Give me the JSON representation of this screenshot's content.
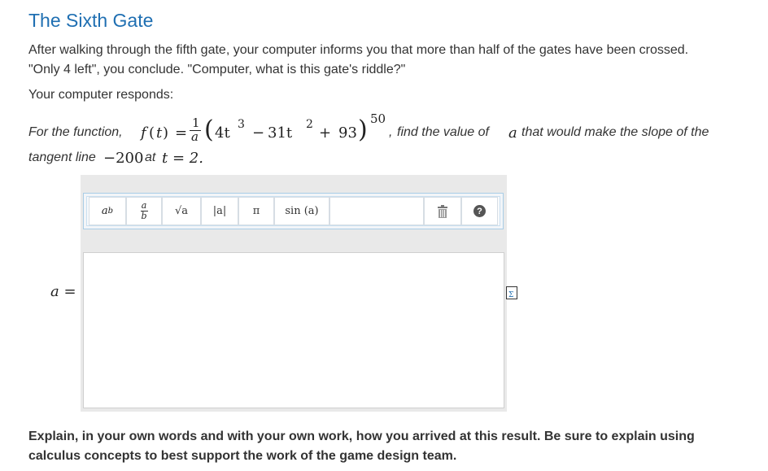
{
  "page": {
    "title": "The Sixth Gate",
    "intro": "After walking through the fifth gate, your computer informs you that more than half of the gates have been crossed. \"Only 4 left\", you conclude. \"Computer, what is this gate's riddle?\"",
    "responds": "Your computer responds:"
  },
  "problem": {
    "lead": "For the function,",
    "func": "f",
    "var": "t",
    "paren_l": "(",
    "paren_r": ")",
    "equals": "=",
    "frac_num": "1",
    "frac_den": "a",
    "term1": "4t",
    "exp1": "3",
    "minus": "−",
    "term2": "31t",
    "exp2": "2",
    "plus": "+",
    "term3": "93",
    "outer_exp": "50",
    "comma": ",",
    "mid": "find the value of",
    "a_var": "a",
    "tail": "that would make the slope of the",
    "line2_lead": "tangent line",
    "slope_value": "−200",
    "at": "at",
    "t_eq": "t = 2."
  },
  "toolbar": {
    "buttons": [
      {
        "name": "exponent",
        "base": "a",
        "sup": "b"
      },
      {
        "name": "fraction",
        "num": "a",
        "den": "b"
      },
      {
        "name": "sqrt",
        "label": "√a"
      },
      {
        "name": "abs",
        "label": "|a|"
      },
      {
        "name": "pi",
        "label": "π"
      },
      {
        "name": "sin",
        "label": "sin (a)"
      },
      {
        "name": "trash",
        "label": ""
      },
      {
        "name": "help",
        "label": "?"
      }
    ],
    "exp_base": "a",
    "exp_sup": "b",
    "frac_num": "a",
    "frac_den": "b",
    "sqrt_label": "√a",
    "abs_label": "|a|",
    "pi_label": "π",
    "sin_label": "sin (a)",
    "help_label": "?"
  },
  "answer": {
    "label": "a =",
    "value": ""
  },
  "explain": "Explain, in your own words and with your own work, how you arrived at this result. Be sure to explain using calculus concepts to best support the work of the game design team.",
  "colors": {
    "title": "#1f6fb2",
    "toolbar_border": "#a9cde6",
    "panel_bg": "#e9e9e9",
    "text": "#333333"
  }
}
